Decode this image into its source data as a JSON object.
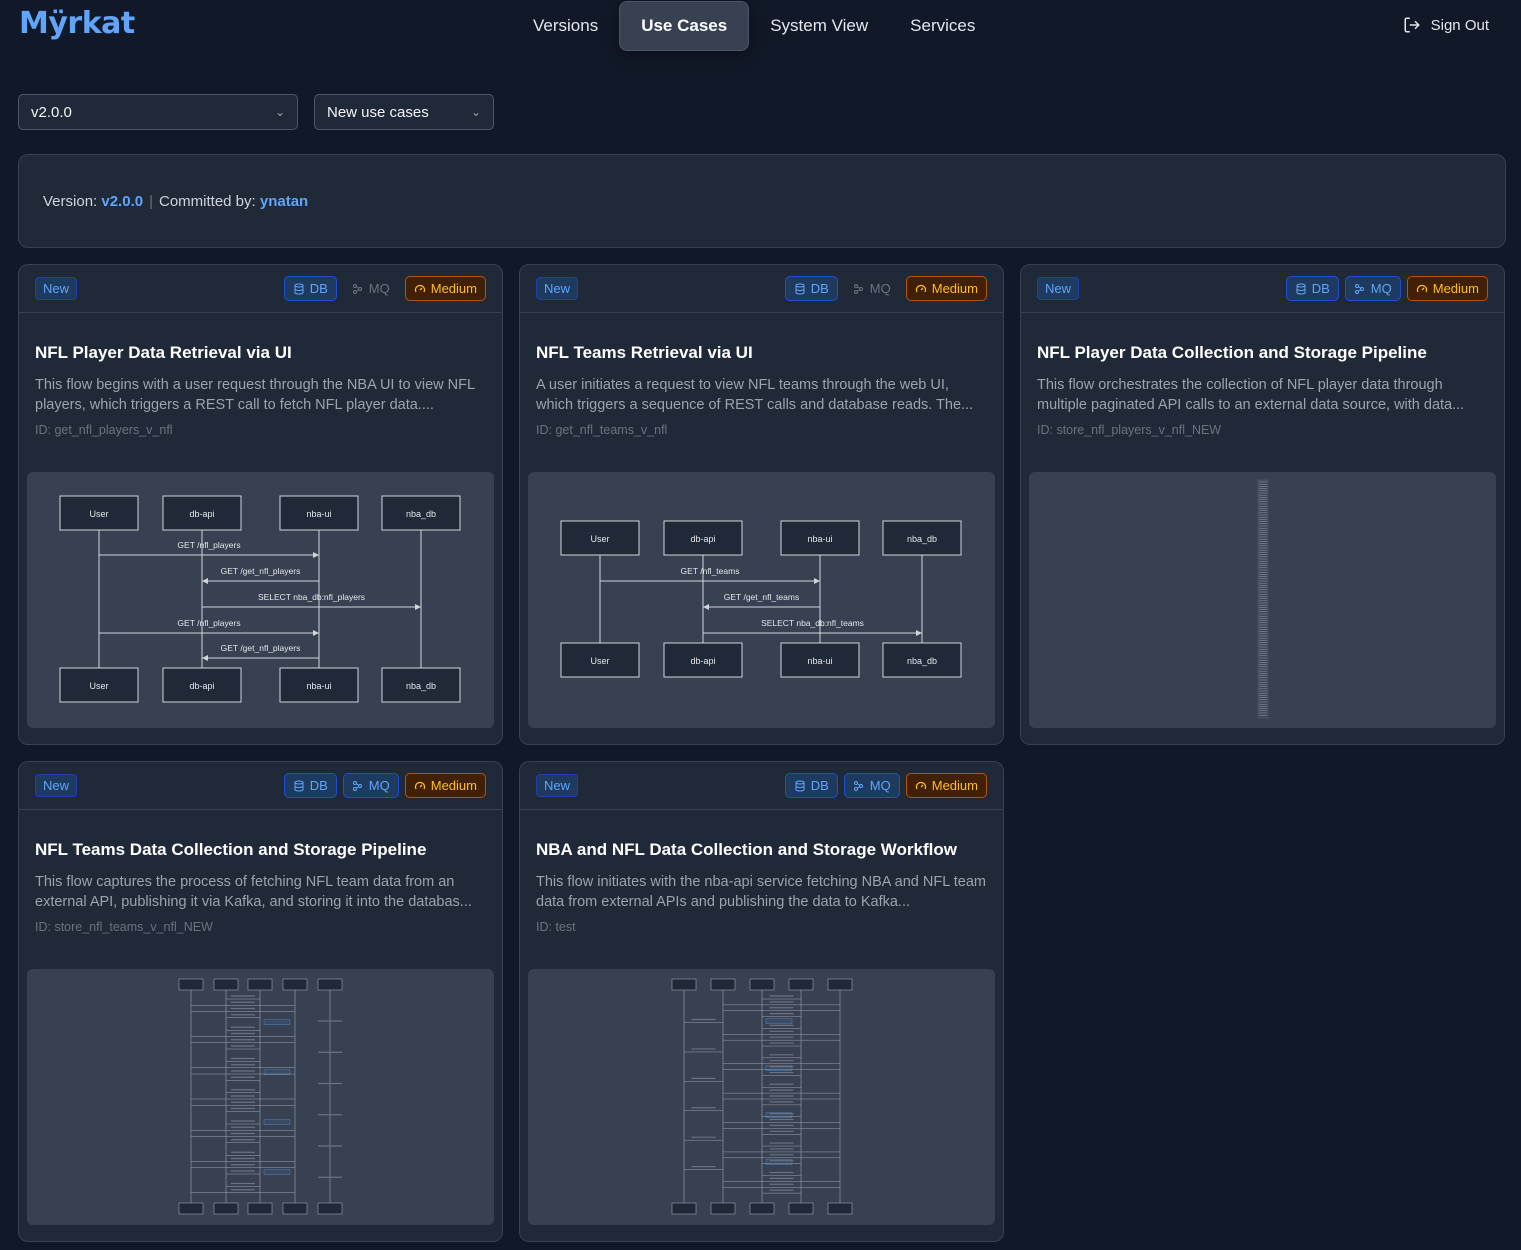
{
  "app": {
    "logo": "Mÿrkat"
  },
  "nav": {
    "tabs": [
      "Versions",
      "Use Cases",
      "System View",
      "Services"
    ],
    "active": "Use Cases"
  },
  "auth": {
    "signout_label": "Sign Out"
  },
  "filters": {
    "version_value": "v2.0.0",
    "usecase_value": "New use cases"
  },
  "info": {
    "version_label": "Version:",
    "version": "v2.0.0",
    "committed_label": "Committed by:",
    "committer": "ynatan"
  },
  "cards": [
    {
      "status": "New",
      "db": "DB",
      "mq": "MQ",
      "mq_active": false,
      "complexity": "Medium",
      "title": "NFL Player Data Retrieval via UI",
      "description": "This flow begins with a user request through the NBA UI to view NFL players, which triggers a REST call to fetch NFL player data....",
      "id": "ID: get_nfl_players_v_nfl",
      "diagram": {
        "participants": [
          "User",
          "db-api",
          "nba-ui",
          "nba_db"
        ],
        "messages": [
          "GET /nfl_players",
          "GET /get_nfl_players",
          "SELECT nba_db:nfl_players",
          "GET /nfl_players",
          "GET /get_nfl_players"
        ]
      }
    },
    {
      "status": "New",
      "db": "DB",
      "mq": "MQ",
      "mq_active": false,
      "complexity": "Medium",
      "title": "NFL Teams Retrieval via UI",
      "description": "A user initiates a request to view NFL teams through the web UI, which triggers a sequence of REST calls and database reads. The...",
      "id": "ID: get_nfl_teams_v_nfl",
      "diagram": {
        "participants": [
          "User",
          "db-api",
          "nba-ui",
          "nba_db"
        ],
        "messages": [
          "GET /nfl_teams",
          "GET /get_nfl_teams",
          "SELECT nba_db:nfl_teams"
        ]
      }
    },
    {
      "status": "New",
      "db": "DB",
      "mq": "MQ",
      "mq_active": true,
      "complexity": "Medium",
      "title": "NFL Player Data Collection and Storage Pipeline",
      "description": "This flow orchestrates the collection of NFL player data through multiple paginated API calls to an external data source, with data...",
      "id": "ID: store_nfl_players_v_nfl_NEW"
    },
    {
      "status": "New",
      "db": "DB",
      "mq": "MQ",
      "mq_active": true,
      "complexity": "Medium",
      "title": "NFL Teams Data Collection and Storage Pipeline",
      "description": "This flow captures the process of fetching NFL team data from an external API, publishing it via Kafka, and storing it into the databas...",
      "id": "ID: store_nfl_teams_v_nfl_NEW"
    },
    {
      "status": "New",
      "db": "DB",
      "mq": "MQ",
      "mq_active": true,
      "complexity": "Medium",
      "title": "NBA and NFL Data Collection and Storage Workflow",
      "description": "This flow initiates with the nba-api service fetching NBA and NFL team data from external APIs and publishing the data to Kafka...",
      "id": "ID: test"
    }
  ],
  "colors": {
    "accent": "#60a5fa",
    "medium": "#fbbf24",
    "bg": "#111827",
    "card": "#1f2937"
  }
}
